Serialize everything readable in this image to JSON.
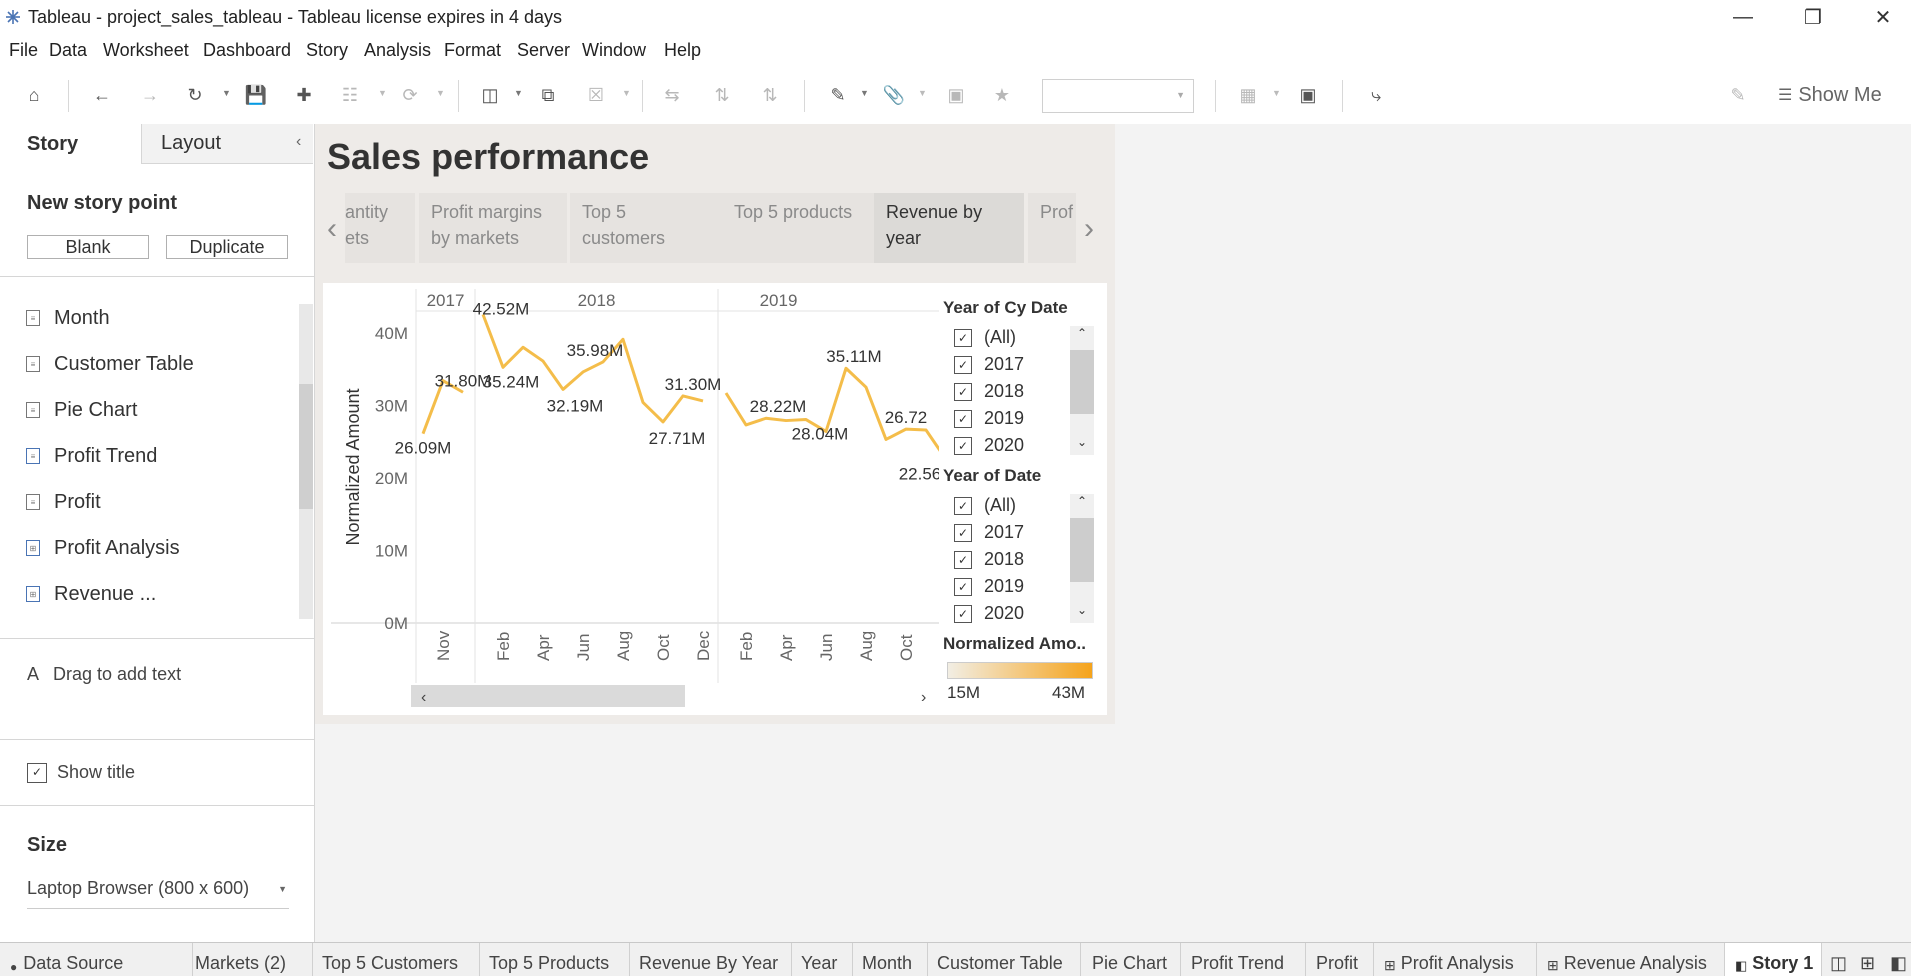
{
  "window": {
    "title": "Tableau - project_sales_tableau - Tableau license expires in 4 days"
  },
  "menu": [
    "File",
    "Data",
    "Worksheet",
    "Dashboard",
    "Story",
    "Analysis",
    "Format",
    "Server",
    "Window",
    "Help"
  ],
  "toolbar": {
    "show_me_label": "Show Me"
  },
  "left_panel": {
    "tab_story": "Story",
    "tab_layout": "Layout",
    "new_story_point": "New story point",
    "blank_button": "Blank",
    "duplicate_button": "Duplicate",
    "sheets": [
      "Month",
      "Customer Table",
      "Pie Chart",
      "Profit Trend",
      "Profit",
      "Profit Analysis",
      "Revenue ..."
    ],
    "drag_text_icon": "A",
    "drag_text": "Drag to add text",
    "show_title": "Show title",
    "size_title": "Size",
    "size_value": "Laptop Browser (800 x 600)"
  },
  "story": {
    "title": "Sales performance",
    "nav_points": [
      {
        "label": "antity\nets"
      },
      {
        "label": "Profit margins\nby markets"
      },
      {
        "label": "Top 5\ncustomers"
      },
      {
        "label": "Top 5 products"
      },
      {
        "label": "Revenue by\nyear"
      },
      {
        "label": "Prof"
      }
    ]
  },
  "legends": {
    "filter1_title": "Year of Cy Date",
    "filter1_items": [
      "(All)",
      "2017",
      "2018",
      "2019",
      "2020"
    ],
    "filter2_title": "Year of Date",
    "filter2_items": [
      "(All)",
      "2017",
      "2018",
      "2019",
      "2020"
    ],
    "color_title": "Normalized Amo..",
    "color_min": "15M",
    "color_max": "43M",
    "colors": {
      "low": "#f2eee4",
      "high": "#f5a31b",
      "line": "#f4bd4a"
    }
  },
  "chart_data": {
    "type": "line",
    "ylabel": "Normalized Amount",
    "y_ticks": [
      "40M",
      "30M",
      "20M",
      "10M",
      "0M"
    ],
    "ylim": [
      0,
      43
    ],
    "years": [
      "2017",
      "2018",
      "2019"
    ],
    "x_ticks": [
      "Nov",
      "Feb",
      "Apr",
      "Jun",
      "Aug",
      "Oct",
      "Dec",
      "Feb",
      "Apr",
      "Jun",
      "Aug",
      "Oct"
    ],
    "series": [
      {
        "values": [
          {
            "x": "2017-10",
            "y": 26.09
          },
          {
            "x": "2017-11",
            "y": 33.4
          },
          {
            "x": "2017-12",
            "y": 31.8
          },
          {
            "x": "2018-01",
            "y": 42.52
          },
          {
            "x": "2018-02",
            "y": 35.24
          },
          {
            "x": "2018-03",
            "y": 38.0
          },
          {
            "x": "2018-04",
            "y": 36.1
          },
          {
            "x": "2018-05",
            "y": 32.19
          },
          {
            "x": "2018-06",
            "y": 34.6
          },
          {
            "x": "2018-07",
            "y": 35.98
          },
          {
            "x": "2018-08",
            "y": 39.1
          },
          {
            "x": "2018-09",
            "y": 30.4
          },
          {
            "x": "2018-10",
            "y": 27.71
          },
          {
            "x": "2018-11",
            "y": 31.3
          },
          {
            "x": "2018-12",
            "y": 30.6
          },
          {
            "x": "2019-01",
            "y": 31.7
          },
          {
            "x": "2019-02",
            "y": 27.3
          },
          {
            "x": "2019-03",
            "y": 28.22
          },
          {
            "x": "2019-04",
            "y": 27.9
          },
          {
            "x": "2019-05",
            "y": 28.04
          },
          {
            "x": "2019-06",
            "y": 26.4
          },
          {
            "x": "2019-07",
            "y": 35.11
          },
          {
            "x": "2019-08",
            "y": 32.5
          },
          {
            "x": "2019-09",
            "y": 25.3
          },
          {
            "x": "2019-10",
            "y": 26.72
          },
          {
            "x": "2019-11",
            "y": 26.6
          },
          {
            "x": "2019-12",
            "y": 22.56
          }
        ]
      }
    ],
    "labels": [
      {
        "text": "26.09M",
        "x": "2017-10",
        "y": 26.09
      },
      {
        "text": "31.80M",
        "x": "2017-12",
        "y": 31.8
      },
      {
        "text": "42.52M",
        "x": "2018-01",
        "y": 42.52
      },
      {
        "text": "35.24M",
        "x": "2018-02",
        "y": 35.24
      },
      {
        "text": "32.19M",
        "x": "2018-05",
        "y": 32.19
      },
      {
        "text": "35.98M",
        "x": "2018-07",
        "y": 35.98
      },
      {
        "text": "27.71M",
        "x": "2018-10",
        "y": 27.71
      },
      {
        "text": "31.30M",
        "x": "2018-11",
        "y": 31.3
      },
      {
        "text": "28.22M",
        "x": "2019-03",
        "y": 28.22
      },
      {
        "text": "28.04M",
        "x": "2019-05",
        "y": 28.04
      },
      {
        "text": "35.11M",
        "x": "2019-07",
        "y": 35.11
      },
      {
        "text": "26.72",
        "x": "2019-10",
        "y": 26.72
      },
      {
        "text": "22.56",
        "x": "2019-12",
        "y": 22.56
      }
    ]
  },
  "bottom_tabs": [
    "Data Source",
    "Markets (2)",
    "Top 5 Customers",
    "Top 5 Products",
    "Revenue By Year",
    "Year",
    "Month",
    "Customer Table",
    "Pie Chart",
    "Profit Trend",
    "Profit",
    "Profit Analysis",
    "Revenue Analysis",
    "Story 1"
  ]
}
